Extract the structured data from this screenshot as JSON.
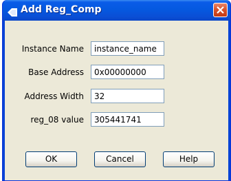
{
  "window": {
    "title": "Add Reg_Comp",
    "title_icon": "app-diamond-icon",
    "close_icon": "close-icon"
  },
  "form": {
    "fields": [
      {
        "label": "Instance Name",
        "value": "instance_name"
      },
      {
        "label": "Base Address",
        "value": "0x00000000"
      },
      {
        "label": "Address Width",
        "value": "32"
      },
      {
        "label": "reg_08 value",
        "value": "305441741"
      }
    ]
  },
  "buttons": {
    "ok": "OK",
    "cancel": "Cancel",
    "help": "Help"
  },
  "colors": {
    "titlebar": "#0a5ce8",
    "client_bg": "#ece9d8",
    "field_border": "#7f9db9",
    "close_red": "#d8532c"
  }
}
